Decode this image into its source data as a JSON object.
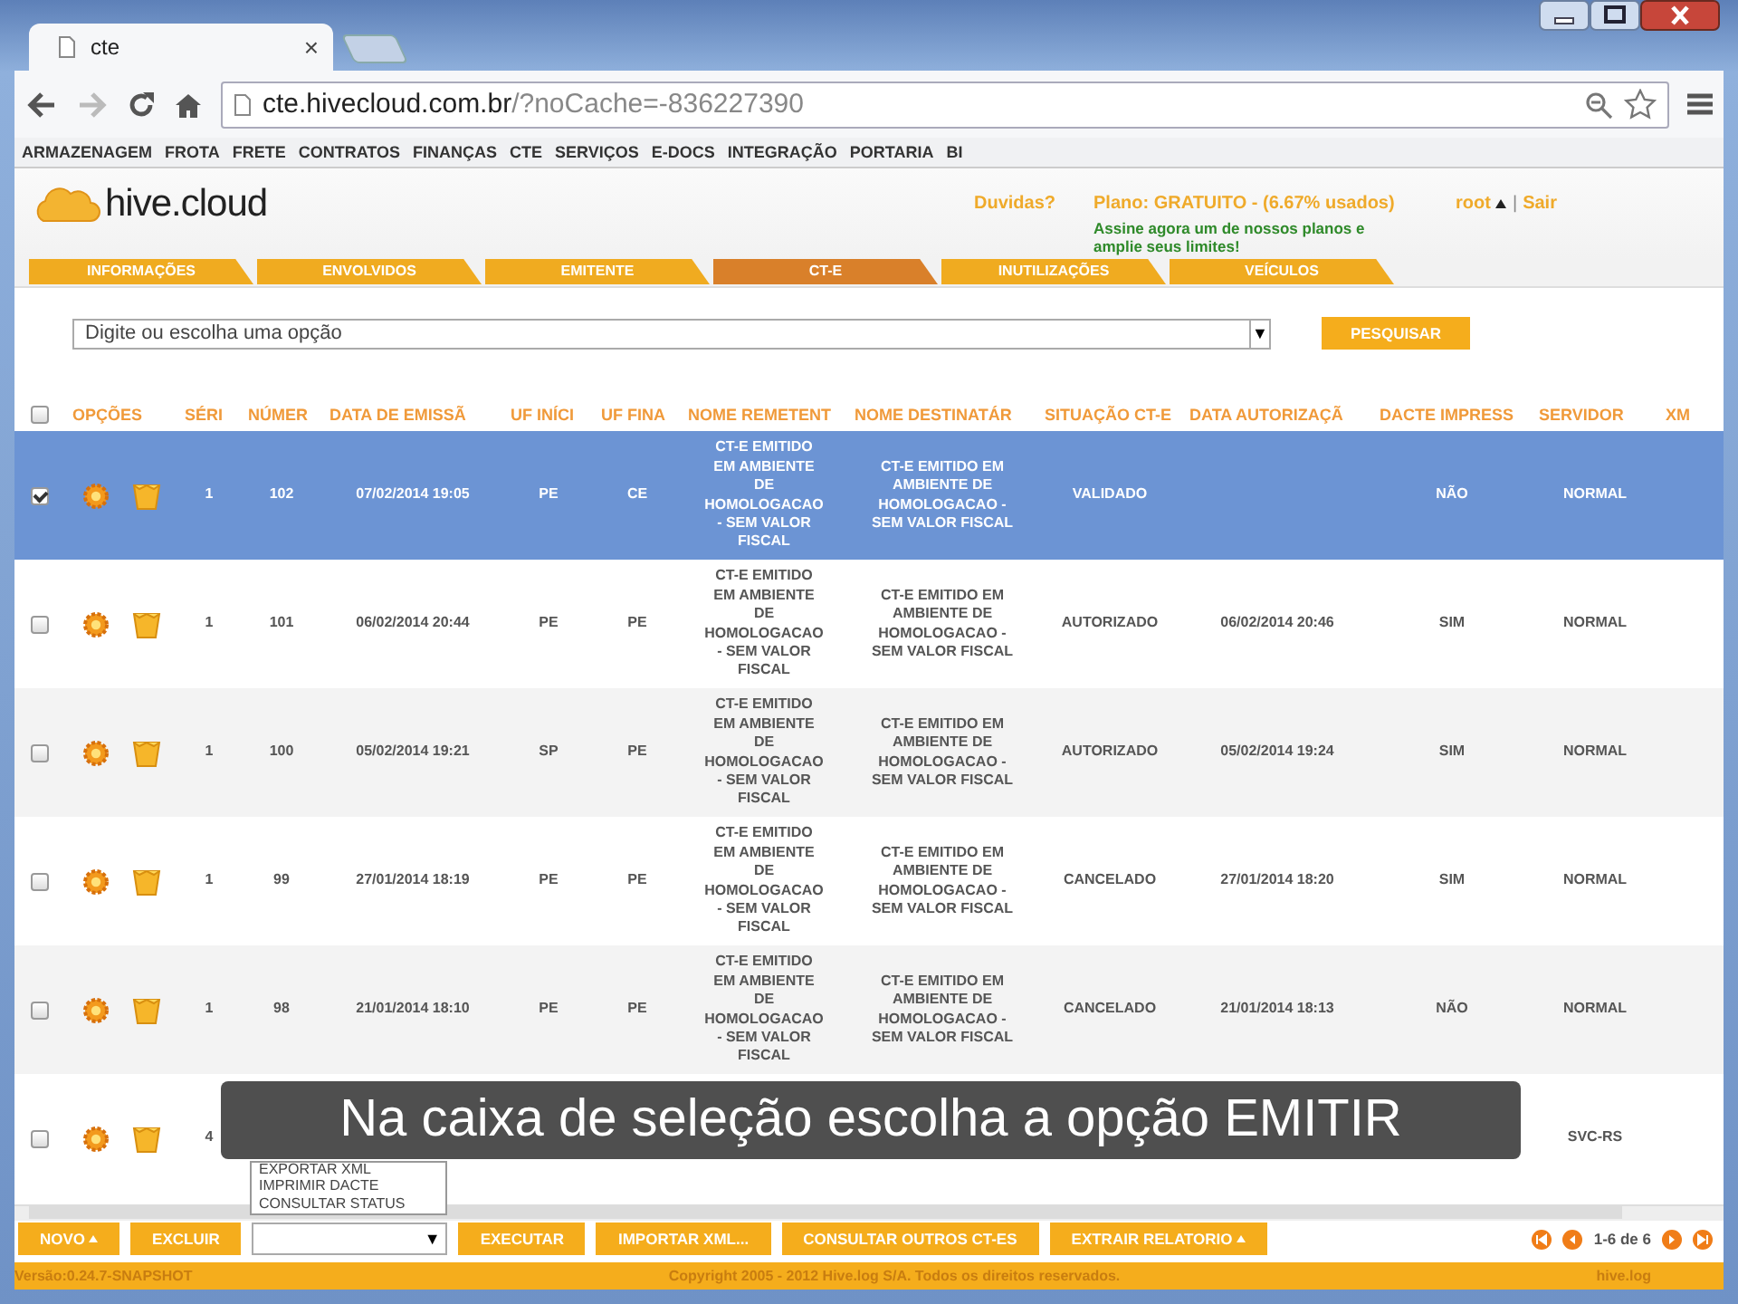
{
  "browser": {
    "tab_title": "cte",
    "tab_close": "×",
    "url_domain": "cte.hivecloud.com.br",
    "url_rest": "/?noCache=-836227390"
  },
  "bookmarks": [
    "ARMAZENAGEM",
    "FROTA",
    "FRETE",
    "CONTRATOS",
    "FINANÇAS",
    "CTE",
    "SERVIÇOS",
    "E-DOCS",
    "INTEGRAÇÃO",
    "PORTARIA",
    "BI"
  ],
  "header": {
    "logo": "hive.cloud",
    "help": "Duvidas?",
    "plan": "Plano: GRATUITO - (6.67% usados)",
    "upgrade": "Assine agora um de nossos planos e amplie seus limites!",
    "user": "root",
    "separator": "|",
    "logout": "Sair"
  },
  "tabs": [
    {
      "label": "INFORMAÇÕES",
      "selected": false
    },
    {
      "label": "ENVOLVIDOS",
      "selected": false
    },
    {
      "label": "EMITENTE",
      "selected": false
    },
    {
      "label": "CT-E",
      "selected": true
    },
    {
      "label": "INUTILIZAÇÕES",
      "selected": false
    },
    {
      "label": "VEÍCULOS",
      "selected": false
    }
  ],
  "search": {
    "placeholder": "Digite ou escolha uma opção",
    "arrow": "▼",
    "button": "PESQUISAR"
  },
  "table": {
    "header_checked": false,
    "columns": [
      "OPÇÕES",
      "SÉRI",
      "NÚMER",
      "DATA DE EMISSÃ",
      "UF INÍCI",
      "UF FINA",
      "NOME REMETENT",
      "NOME DESTINATÁR",
      "SITUAÇÃO CT-E",
      "DATA AUTORIZAÇÃ",
      "DACTE IMPRESS",
      "SERVIDOR",
      "XM"
    ],
    "rows": [
      {
        "selected": true,
        "checked": true,
        "serie": "1",
        "numero": "102",
        "data_emissao": "07/02/2014 19:05",
        "uf_inicio": "PE",
        "uf_final": "CE",
        "remetente": "CT-E EMITIDO EM AMBIENTE DE HOMOLOGACAO - SEM VALOR FISCAL",
        "destinatario": "CT-E EMITIDO EM AMBIENTE DE HOMOLOGACAO - SEM VALOR FISCAL",
        "situacao": "VALIDADO",
        "dacte": "NÃO",
        "servidor": "NORMAL"
      },
      {
        "selected": false,
        "checked": false,
        "serie": "1",
        "numero": "101",
        "data_emissao": "06/02/2014 20:44",
        "uf_inicio": "PE",
        "uf_final": "PE",
        "remetente": "CT-E EMITIDO EM AMBIENTE DE HOMOLOGACAO - SEM VALOR FISCAL",
        "destinatario": "CT-E EMITIDO EM AMBIENTE DE HOMOLOGACAO - SEM VALOR FISCAL",
        "situacao": "AUTORIZADO",
        "data_autorizacao": "06/02/2014 20:46",
        "dacte": "SIM",
        "servidor": "NORMAL"
      },
      {
        "selected": false,
        "checked": false,
        "serie": "1",
        "numero": "100",
        "data_emissao": "05/02/2014 19:21",
        "uf_inicio": "SP",
        "uf_final": "PE",
        "remetente": "CT-E EMITIDO EM AMBIENTE DE HOMOLOGACAO - SEM VALOR FISCAL",
        "destinatario": "CT-E EMITIDO EM AMBIENTE DE HOMOLOGACAO - SEM VALOR FISCAL",
        "situacao": "AUTORIZADO",
        "data_autorizacao": "05/02/2014 19:24",
        "dacte": "SIM",
        "servidor": "NORMAL"
      },
      {
        "selected": false,
        "checked": false,
        "serie": "1",
        "numero": "99",
        "data_emissao": "27/01/2014 18:19",
        "uf_inicio": "PE",
        "uf_final": "PE",
        "remetente": "CT-E EMITIDO EM AMBIENTE DE HOMOLOGACAO - SEM VALOR FISCAL",
        "destinatario": "CT-E EMITIDO EM AMBIENTE DE HOMOLOGACAO - SEM VALOR FISCAL",
        "situacao": "CANCELADO",
        "data_autorizacao": "27/01/2014 18:20",
        "dacte": "SIM",
        "servidor": "NORMAL"
      },
      {
        "selected": false,
        "checked": false,
        "serie": "1",
        "numero": "98",
        "data_emissao": "21/01/2014 18:10",
        "uf_inicio": "PE",
        "uf_final": "PE",
        "remetente": "CT-E EMITIDO EM AMBIENTE DE HOMOLOGACAO - SEM VALOR FISCAL",
        "destinatario": "CT-E EMITIDO EM AMBIENTE DE HOMOLOGACAO - SEM VALOR FISCAL",
        "situacao": "CANCELADO",
        "data_autorizacao": "21/01/2014 18:13",
        "dacte": "NÃO",
        "servidor": "NORMAL"
      },
      {
        "selected": false,
        "checked": false,
        "serie": "4",
        "servidor": "SVC-RS"
      }
    ]
  },
  "action_menu": {
    "arrow": "▼",
    "options": [
      "EXPORTAR XML",
      "IMPRIMIR DACTE",
      "CONSULTAR STATUS"
    ]
  },
  "buttons": [
    {
      "label": "NOVO",
      "kind": "menu"
    },
    {
      "label": "EXCLUIR",
      "kind": "plain"
    },
    {
      "kind": "select"
    },
    {
      "label": "EXECUTAR",
      "kind": "plain"
    },
    {
      "label": "IMPORTAR XML...",
      "kind": "plain"
    },
    {
      "label": "CONSULTAR OUTROS CT-ES",
      "kind": "plain"
    },
    {
      "label": "EXTRAIR RELATORIO",
      "kind": "menu"
    }
  ],
  "pagination": "1-6 de 6",
  "footer": {
    "version": "Versão:0.24.7-SNAPSHOT",
    "copyright": "Copyright 2005 - 2012 Hive.log S/A. Todos os direitos reservados.",
    "brand": "hive.log"
  },
  "caption": "Na caixa de seleção escolha a opção EMITIR"
}
